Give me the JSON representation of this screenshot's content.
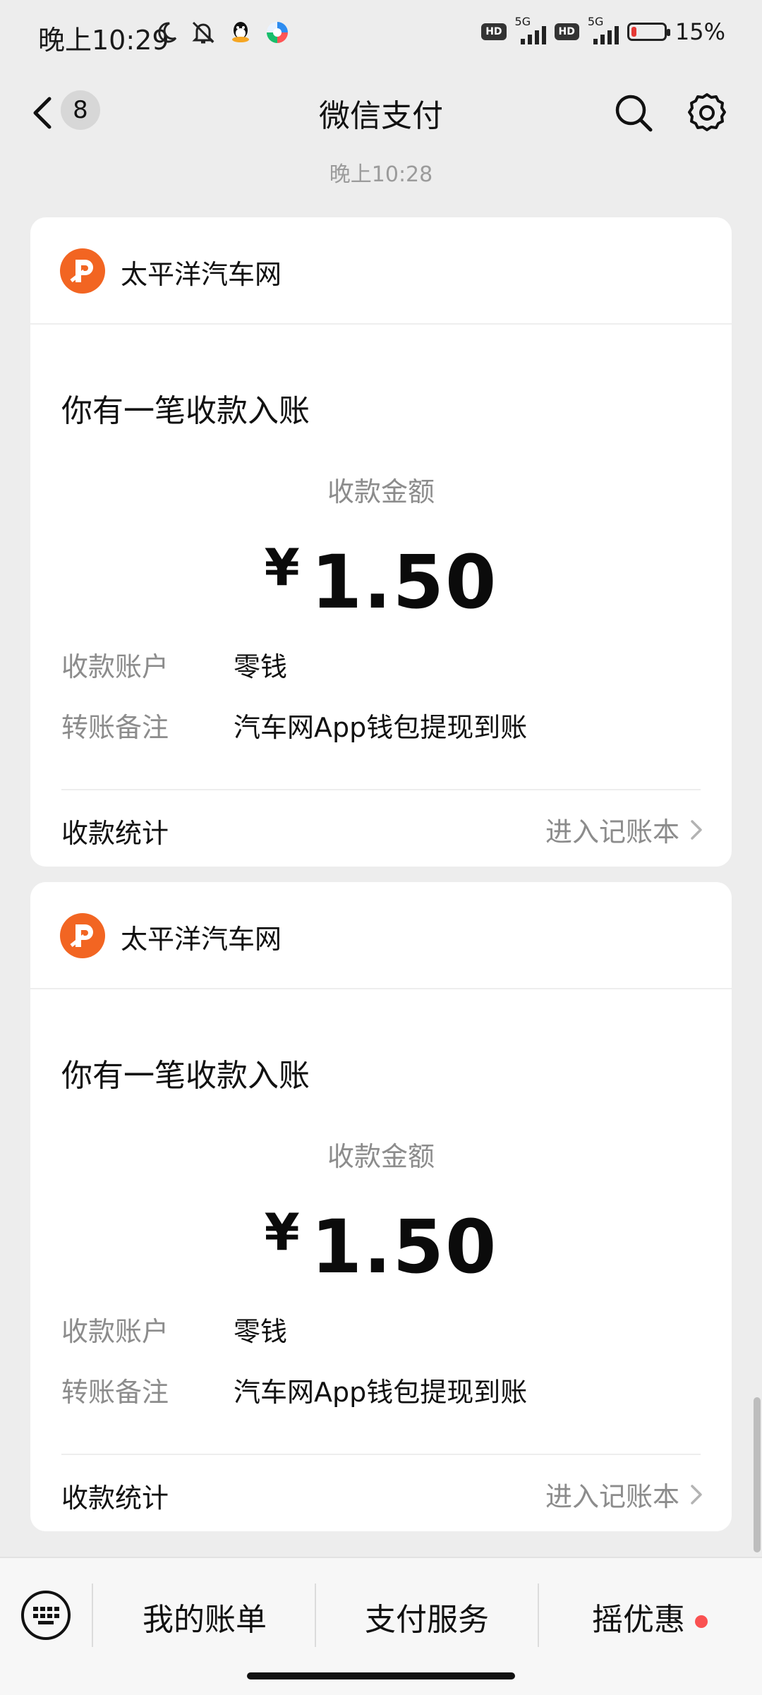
{
  "status_bar": {
    "time": "晚上10:29",
    "net1": "5G",
    "net2": "5G",
    "hd1": "HD",
    "hd2": "HD",
    "battery": "15%",
    "battery_level": 0.15,
    "colors": {
      "battery_low": "#e53935"
    },
    "icons": [
      "moon-icon",
      "bell-off-icon",
      "qq-icon",
      "app-icon"
    ]
  },
  "header": {
    "title": "微信支付",
    "unread_count": "8"
  },
  "timestamp": "晚上10:28",
  "cards": [
    {
      "merchant": "太平洋汽车网",
      "notice": "你有一笔收款入账",
      "amount_label": "收款金额",
      "currency": "¥",
      "amount": "1.50",
      "account_label": "收款账户",
      "account_value": "零钱",
      "remark_label": "转账备注",
      "remark_value": "汽车网App钱包提现到账",
      "stats_label": "收款统计",
      "ledger_link": "进入记账本"
    },
    {
      "merchant": "太平洋汽车网",
      "notice": "你有一笔收款入账",
      "amount_label": "收款金额",
      "currency": "¥",
      "amount": "1.50",
      "account_label": "收款账户",
      "account_value": "零钱",
      "remark_label": "转账备注",
      "remark_value": "汽车网App钱包提现到账",
      "stats_label": "收款统计",
      "ledger_link": "进入记账本"
    }
  ],
  "bottom_menu": {
    "items": [
      "我的账单",
      "支付服务",
      "摇优惠"
    ],
    "colors": {
      "dot": "#fa5151"
    }
  },
  "brand": {
    "logo_color": "#f26522"
  }
}
